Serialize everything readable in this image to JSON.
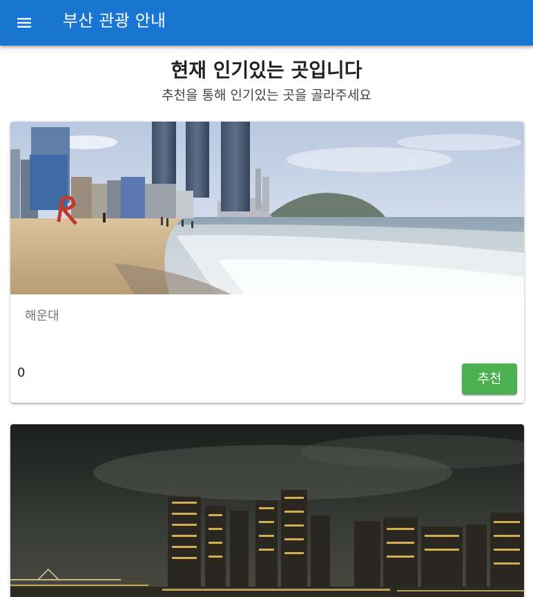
{
  "app": {
    "title": "부산 관광 안내",
    "menu_icon": "menu-icon",
    "accent_color": "#1976d2"
  },
  "header": {
    "title": "현재 인기있는 곳입니다",
    "subtitle": "추천을 통해 인기있는 곳을 골라주세요"
  },
  "places": [
    {
      "name": "해운대",
      "votes": "0",
      "button_label": "추천",
      "button_color": "#4caf50",
      "image": "beach-skyline-photo"
    },
    {
      "image": "night-city-skyline-photo"
    }
  ]
}
